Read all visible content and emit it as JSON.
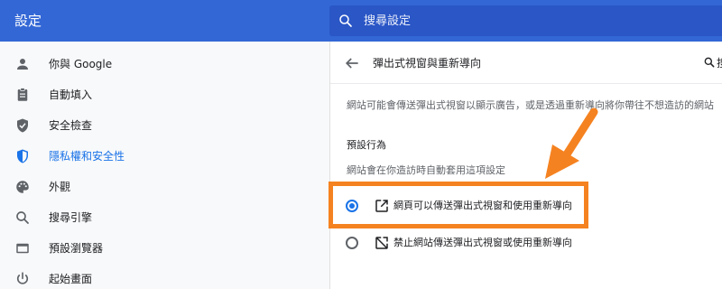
{
  "header": {
    "title": "設定",
    "search_placeholder": "搜尋設定"
  },
  "sidebar": {
    "items": [
      {
        "label": "你與 Google",
        "icon": "person-icon",
        "active": false
      },
      {
        "label": "自動填入",
        "icon": "clipboard-icon",
        "active": false
      },
      {
        "label": "安全檢查",
        "icon": "shield-check-icon",
        "active": false
      },
      {
        "label": "隱私權和安全性",
        "icon": "privacy-shield-icon",
        "active": true
      },
      {
        "label": "外觀",
        "icon": "palette-icon",
        "active": false
      },
      {
        "label": "搜尋引擎",
        "icon": "search-icon",
        "active": false
      },
      {
        "label": "預設瀏覽器",
        "icon": "browser-icon",
        "active": false
      },
      {
        "label": "起始畫面",
        "icon": "power-icon",
        "active": false
      }
    ]
  },
  "main": {
    "title": "彈出式視窗與重新導向",
    "header_search_text": "搜",
    "description": "網站可能會傳送彈出式視窗以顯示廣告，或是透過重新導向將你帶往不想造訪的網站",
    "section_heading": "預設行為",
    "section_sub": "網站會在你造訪時自動套用這項設定",
    "options": [
      {
        "label": "網頁可以傳送彈出式視窗和使用重新導向",
        "icon": "open-in-new-icon",
        "checked": true
      },
      {
        "label": "禁止網站傳送彈出式視窗或使用重新導向",
        "icon": "blocked-popup-icon",
        "checked": false
      }
    ]
  },
  "annotation": {
    "color": "#f58220"
  },
  "colors": {
    "header_bg": "#3367d6",
    "accent": "#1a73e8",
    "sidebar_bg": "#f8f9fa"
  }
}
